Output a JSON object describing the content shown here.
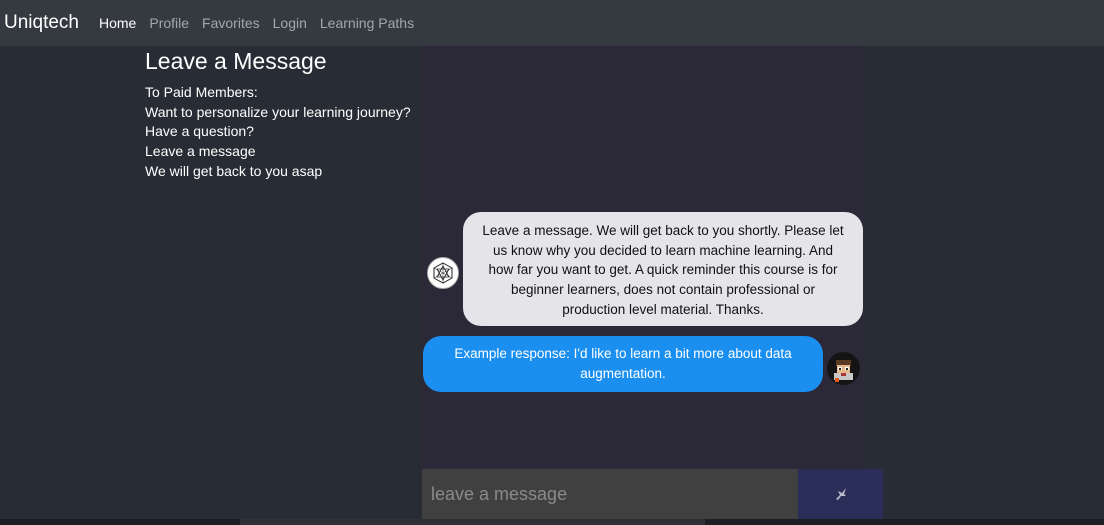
{
  "navbar": {
    "brand": "Uniqtech",
    "links": [
      {
        "label": "Home",
        "active": true
      },
      {
        "label": "Profile",
        "active": false
      },
      {
        "label": "Favorites",
        "active": false
      },
      {
        "label": "Login",
        "active": false
      },
      {
        "label": "Learning Paths",
        "active": false
      }
    ]
  },
  "info": {
    "title": "Leave a Message",
    "lines": [
      "To Paid Members:",
      "Want to personalize your learning journey?",
      "Have a question?",
      "Leave a message",
      "We will get back to you asap"
    ]
  },
  "chat": {
    "messages": [
      {
        "sender": "bot",
        "avatar_icon": "geometric-logo-icon",
        "text": "Leave a message. We will get back to you shortly. Please let us know why you decided to learn machine learning. And how far you want to get. A quick reminder this course is for beginner learners, does not contain professional or production level material. Thanks."
      },
      {
        "sender": "user",
        "avatar_icon": "pixel-character-icon",
        "text": "Example response: I'd like to learn a bit more about data augmentation."
      }
    ]
  },
  "composer": {
    "placeholder": "leave a message",
    "value": "",
    "send_icon": "bird-send-icon"
  },
  "colors": {
    "navbar_bg": "#343a40",
    "page_bg": "#282c34",
    "chat_bg": "#2b2937",
    "bot_bubble": "#e4e4e9",
    "user_bubble": "#1a8ff0",
    "input_bg": "#404040",
    "send_bg": "#2c2e5a"
  }
}
